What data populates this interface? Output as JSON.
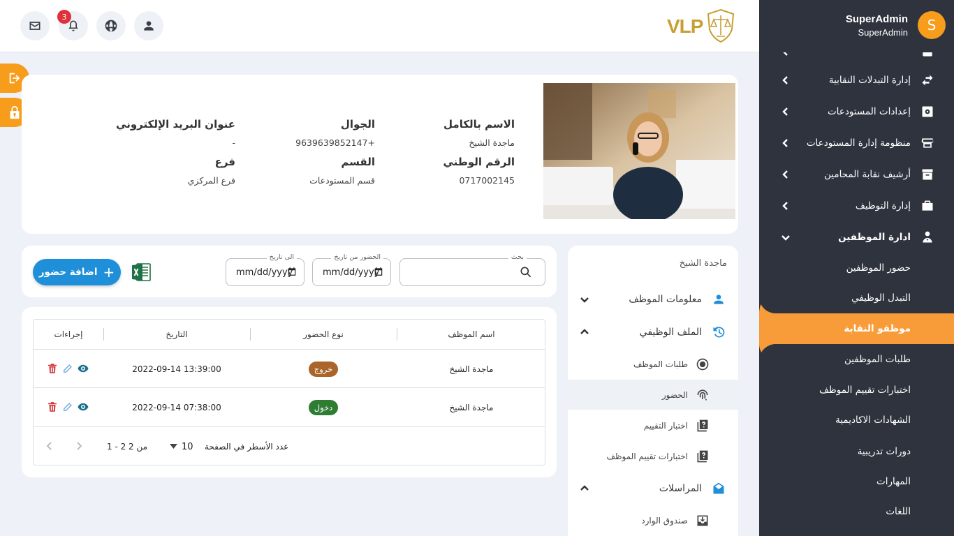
{
  "user": {
    "initial": "S",
    "name": "SuperAdmin",
    "role": "SuperAdmin"
  },
  "notifications": {
    "count": "3"
  },
  "logo": {
    "text": "VLP"
  },
  "sidebar": {
    "items": [
      {
        "label": "إدارة التبدلات النقابية",
        "icon": "swap-icon"
      },
      {
        "label": "إعدادات المستودعات",
        "icon": "gear-box-icon"
      },
      {
        "label": "منظومة إدارة المستودعات",
        "icon": "store-icon"
      },
      {
        "label": "أرشيف نقابة المحامين",
        "icon": "archive-icon"
      },
      {
        "label": "إدارة التوظيف",
        "icon": "briefcase-icon"
      },
      {
        "label": "ادارة الموظفين",
        "icon": "employees-icon"
      }
    ],
    "subitems": [
      "حضور الموظفين",
      "التبدل الوظيفي",
      "موظفو النقابة",
      "طلبات الموظفين",
      "اختبارات تقييم الموظف",
      "الشهادات الاكاديمية",
      "دورات تدريبية",
      "المهارات",
      "اللغات"
    ]
  },
  "profile": {
    "full_name_label": "الاسم بالكامل",
    "full_name": "ماجدة الشيخ",
    "national_id_label": "الرقم الوطني",
    "national_id": "0717002145",
    "mobile_label": "الجوال",
    "mobile": "9639639852147+",
    "department_label": "القسم",
    "department": "قسم المستودعات",
    "email_label": "عنوان البريد الإلكتروني",
    "email": "-",
    "branch_label": "فرع",
    "branch": "فرع المركزي"
  },
  "employee_nav": {
    "name": "ماجدة الشيخ",
    "sections": [
      {
        "label": "معلومات الموظف",
        "icon": "person-icon"
      },
      {
        "label": "الملف الوظيفي",
        "icon": "history-icon"
      },
      {
        "label": "المراسلات",
        "icon": "mail-open-icon"
      }
    ],
    "subitems": [
      {
        "label": "طلبات الموظف",
        "icon": "radio-icon"
      },
      {
        "label": "الحضور",
        "icon": "fingerprint-icon"
      },
      {
        "label": "اختبار التقييم",
        "icon": "quiz-icon"
      },
      {
        "label": "اختبارات تقييم الموظف",
        "icon": "quiz-icon"
      },
      {
        "label": "صندوق الوارد",
        "icon": "inbox-icon"
      }
    ]
  },
  "filters": {
    "search_label": "بحث",
    "from_label": "الحضور من تاريخ",
    "from_value": "mm/dd/yyyy",
    "to_label": "الى تاريخ",
    "to_value": "mm/dd/yyyy",
    "add_button": "اضافة حضور"
  },
  "table": {
    "headers": [
      "اسم الموظف",
      "نوع الحضور",
      "التاريخ",
      "إجراءات"
    ],
    "rows": [
      {
        "name": "ماجدة الشيخ",
        "type": "خروج",
        "type_color": "#a9652a",
        "date": "2022-09-14 13:39:00"
      },
      {
        "name": "ماجدة الشيخ",
        "type": "دخول",
        "type_color": "#2e7d32",
        "date": "2022-09-14 07:38:00"
      }
    ],
    "rows_per_page_label": "عدد الأسطر في الصفحة",
    "rows_per_page": "10",
    "range": "1 - 2 من 2"
  },
  "colors": {
    "accent": "#f89c1c",
    "primary": "#1f8fd9",
    "sidebar": "#2f333e"
  }
}
